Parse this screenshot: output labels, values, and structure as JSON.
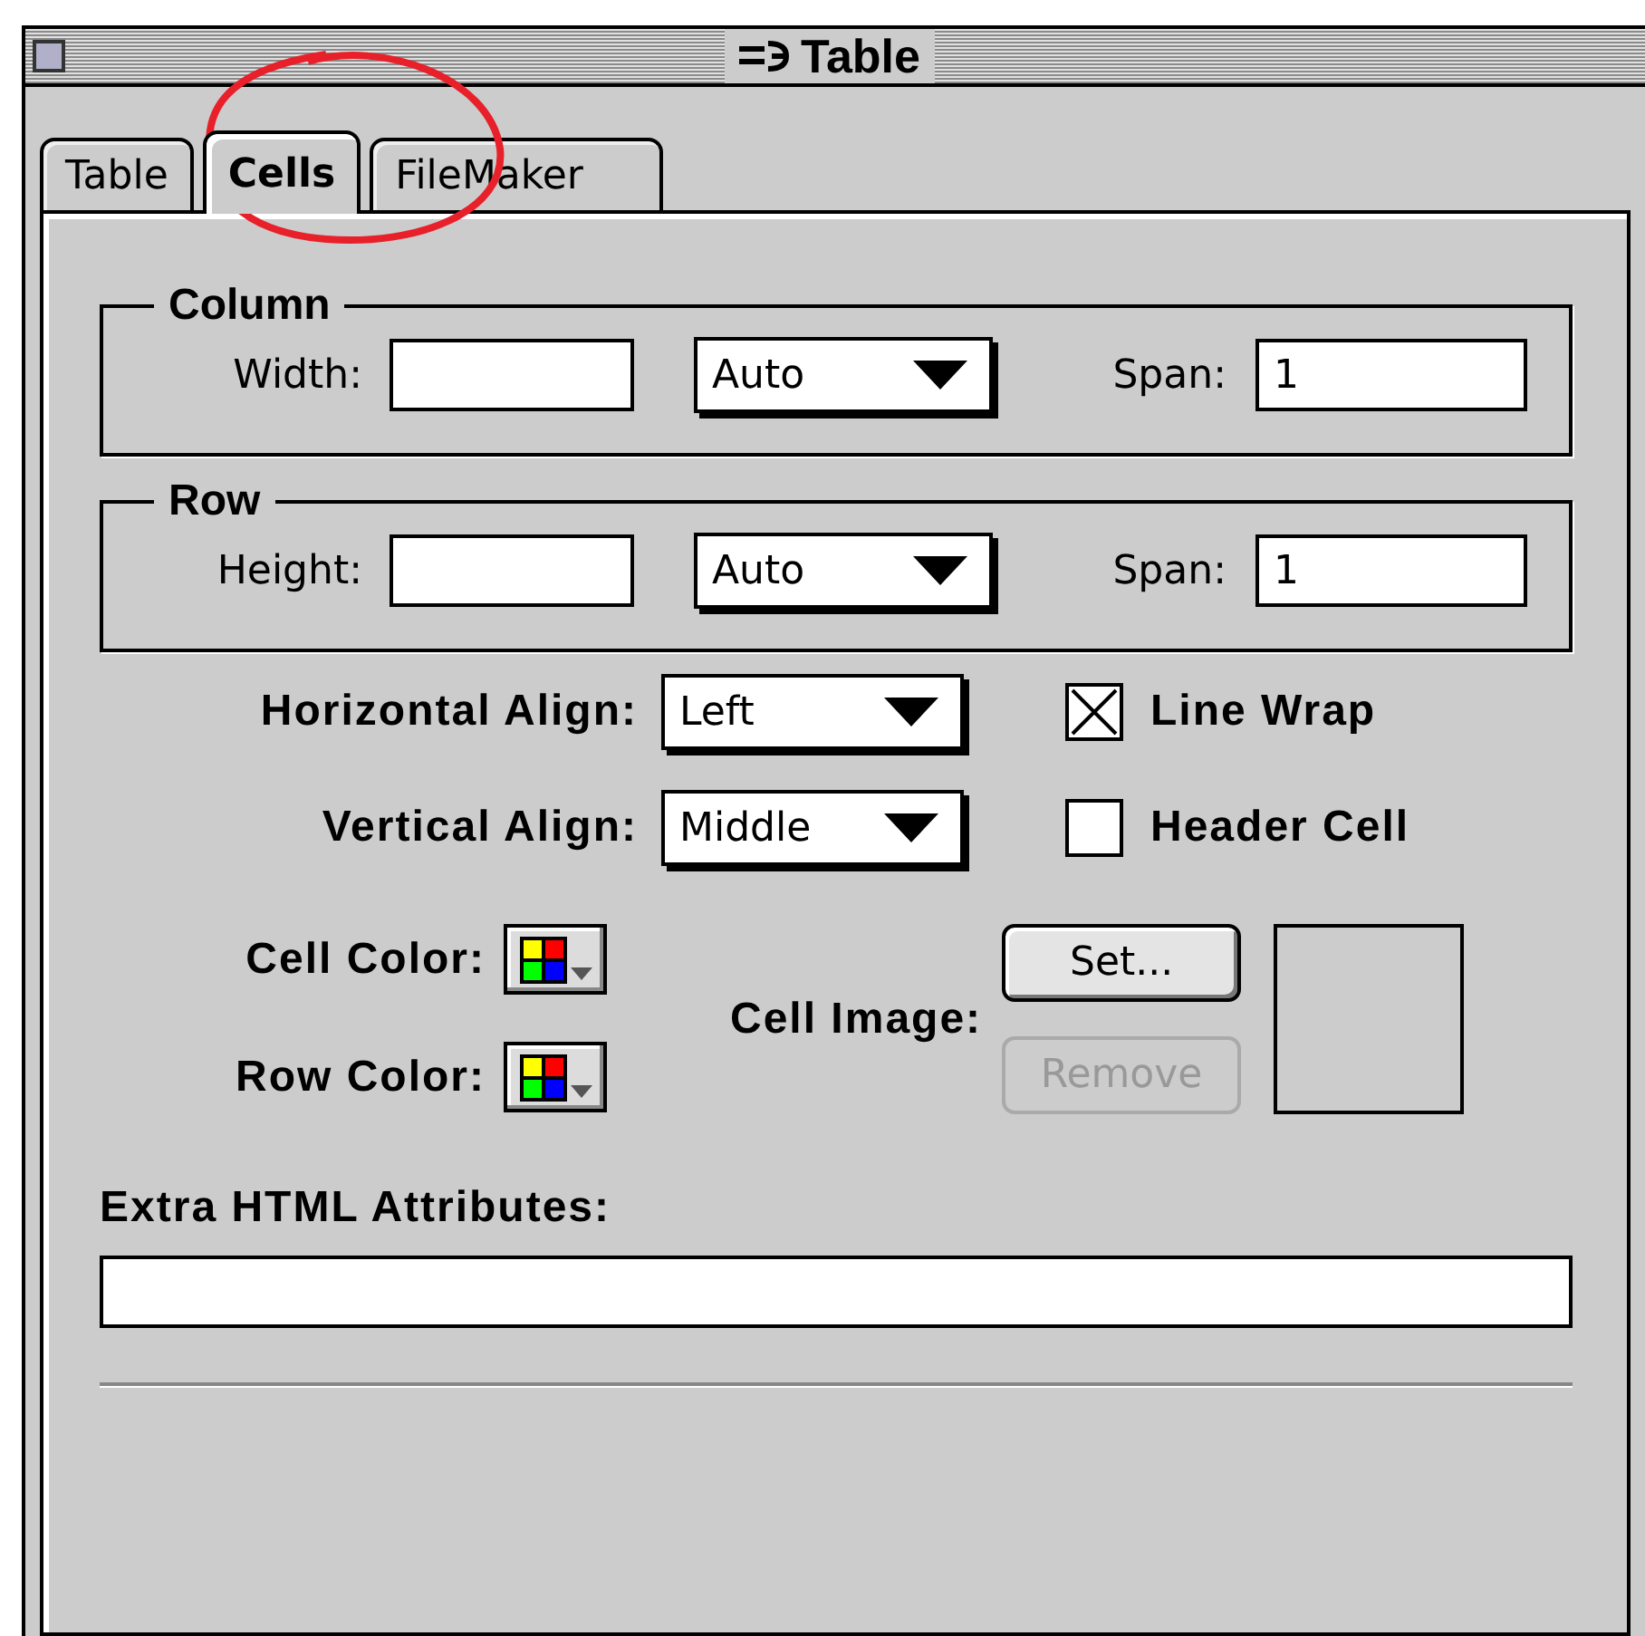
{
  "window": {
    "title": "Table"
  },
  "tabs": [
    {
      "label": "Table",
      "selected": false
    },
    {
      "label": "Cells",
      "selected": true
    },
    {
      "label": "FileMaker",
      "selected": false
    }
  ],
  "groups": [
    {
      "title": "Column",
      "size_label": "Width:",
      "mode": "Auto",
      "span_label": "Span:",
      "span_value": "1"
    },
    {
      "title": "Row",
      "size_label": "Height:",
      "mode": "Auto",
      "span_label": "Span:",
      "span_value": "1"
    }
  ],
  "aligns": [
    {
      "label": "Horizontal Align:",
      "value": "Left"
    },
    {
      "label": "Vertical Align:",
      "value": "Middle"
    }
  ],
  "checkboxes": [
    {
      "label": "Line Wrap",
      "checked": true
    },
    {
      "label": "Header Cell",
      "checked": false
    }
  ],
  "colors": [
    {
      "label": "Cell Color:"
    },
    {
      "label": "Row Color:"
    }
  ],
  "cell_image": {
    "label": "Cell Image:",
    "buttons": [
      {
        "label": "Set...",
        "disabled": false
      },
      {
        "label": "Remove",
        "disabled": true
      }
    ]
  },
  "extra_attributes": {
    "label": "Extra HTML Attributes:"
  }
}
